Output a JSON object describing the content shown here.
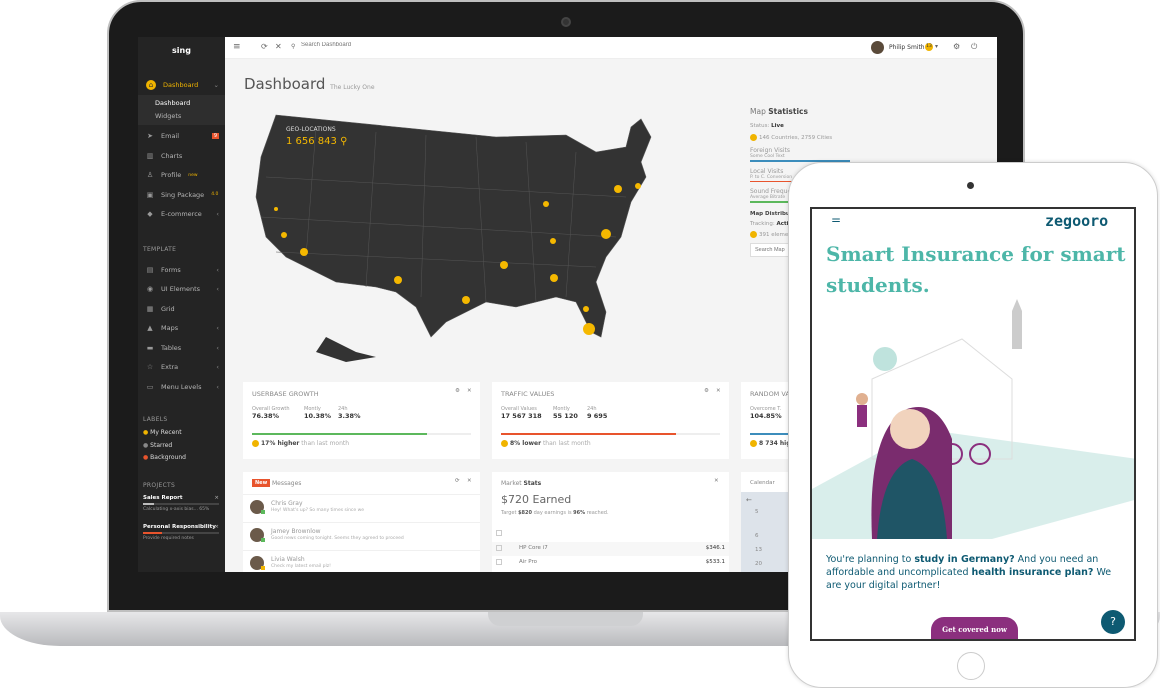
{
  "sidebar": {
    "logo": "sing",
    "items": [
      {
        "label": "Dashboard",
        "icon": "home-icon",
        "active": true
      },
      {
        "label": "Email",
        "icon": "paper-plane-icon",
        "badge": "9"
      },
      {
        "label": "Charts",
        "icon": "chart-icon"
      },
      {
        "label": "Profile",
        "icon": "user-icon",
        "sup": "new"
      },
      {
        "label": "Sing Package",
        "icon": "package-icon",
        "sup": "4.0"
      },
      {
        "label": "E-commerce",
        "icon": "diamond-icon"
      }
    ],
    "sub_items": [
      "Dashboard",
      "Widgets"
    ],
    "template_header": "TEMPLATE",
    "template_items": [
      {
        "label": "Forms",
        "icon": "file-icon"
      },
      {
        "label": "UI Elements",
        "icon": "globe-icon"
      },
      {
        "label": "Grid",
        "icon": "grid-icon"
      },
      {
        "label": "Maps",
        "icon": "map-icon"
      },
      {
        "label": "Tables",
        "icon": "table-icon"
      },
      {
        "label": "Extra",
        "icon": "star-icon"
      },
      {
        "label": "Menu Levels",
        "icon": "folder-icon"
      }
    ],
    "labels_header": "LABELS",
    "labels": [
      {
        "label": "My Recent",
        "color": "#f0b400"
      },
      {
        "label": "Starred",
        "color": "#888888"
      },
      {
        "label": "Background",
        "color": "#e8542d"
      }
    ],
    "projects_header": "PROJECTS",
    "projects": [
      {
        "name": "Sales Report",
        "note": "Calculating x-axis bias... 65%",
        "progress": 0.15,
        "color": "#bbbbbb"
      },
      {
        "name": "Personal Responsibility",
        "note": "Provide required notes",
        "progress": 0.25,
        "color": "#e8542d"
      }
    ]
  },
  "topbar": {
    "search_placeholder": "Search Dashboard",
    "user": "Philip Smith",
    "user_badge": "13"
  },
  "page": {
    "title": "Dashboard",
    "subtitle": "The Lucky One"
  },
  "map": {
    "geo_label": "GEO-LOCATIONS",
    "geo_value": "1 656 843"
  },
  "map_stats": {
    "title_light": "Map",
    "title_bold": "Statistics",
    "status_label": "Status:",
    "status_value": "Live",
    "countries": "146 Countries, 2759 Cities",
    "rows": [
      {
        "label": "Foreign Visits",
        "sub": "Some Cool Text",
        "color": "#3c8dbc"
      },
      {
        "label": "Local Visits",
        "sub": "P. to C. Conversion",
        "color": "#e8542d"
      },
      {
        "label": "Sound Frequencies",
        "sub": "Average Bitrate",
        "color": "#5cb85c"
      }
    ],
    "dist_title": "Map Distributions",
    "tracking_label": "Tracking:",
    "tracking_value": "Active",
    "elements": "391 elements installed",
    "search_placeholder": "Search Map"
  },
  "widgets": [
    {
      "title": "USERBASE GROWTH",
      "stats": [
        {
          "label": "Overall Growth",
          "value": "76.38%"
        },
        {
          "label": "Montly",
          "value": "10.38%"
        },
        {
          "label": "24h",
          "value": "3.38%"
        }
      ],
      "progress": 0.8,
      "color": "#5cb85c",
      "delta_bold": "17% higher",
      "delta_rest": "than last month"
    },
    {
      "title": "TRAFFIC VALUES",
      "stats": [
        {
          "label": "Overall Values",
          "value": "17 567 318"
        },
        {
          "label": "Montly",
          "value": "55 120"
        },
        {
          "label": "24h",
          "value": "9 695"
        }
      ],
      "progress": 0.8,
      "color": "#e8542d",
      "delta_bold": "8% lower",
      "delta_rest": "than last month"
    },
    {
      "title": "RANDOM VALUES",
      "stats": [
        {
          "label": "Overcome T.",
          "value": "104.85%"
        }
      ],
      "progress": 0.8,
      "color": "#3c8dbc",
      "delta_bold": "8 734 higher",
      "delta_rest": ""
    }
  ],
  "messages": {
    "badge": "New",
    "title": "Messages",
    "items": [
      {
        "name": "Chris Gray",
        "text": "Hey! What's up? So many times since we",
        "status": "#5cb85c"
      },
      {
        "name": "Jamey Brownlow",
        "text": "Good news coming tonight. Seems they agreed to proceed",
        "status": "#5cb85c"
      },
      {
        "name": "Livia Walsh",
        "text": "Check my latest email plz!",
        "status": "#f0b400"
      }
    ]
  },
  "market": {
    "title_light": "Market",
    "title_bold": "Stats",
    "earned": "$720 Earned",
    "target_pre": "Target",
    "target_val": "$820",
    "target_mid": "day earnings is",
    "target_pct": "96%",
    "target_post": "reached.",
    "rows": [
      {
        "name": "HP Core i7",
        "price": "$346.1"
      },
      {
        "name": "Air Pro",
        "price": "$533.1"
      }
    ]
  },
  "calendar": {
    "title": "Calendar",
    "days": [
      "5",
      "6",
      "13",
      "20"
    ]
  },
  "tablet": {
    "logo": "zegooro",
    "headline": "Smart Insurance for smart students.",
    "p1": "You're planning to ",
    "b1": "study in Germany?",
    "p2": " And you need an affordable and uncomplicated ",
    "b2": "health insurance plan?",
    "p3": " We are your digital partner!",
    "cta": "Get covered now",
    "accent": "#4db6a8",
    "brand": "#0e5a72",
    "cta_color": "#8b2f7e"
  }
}
